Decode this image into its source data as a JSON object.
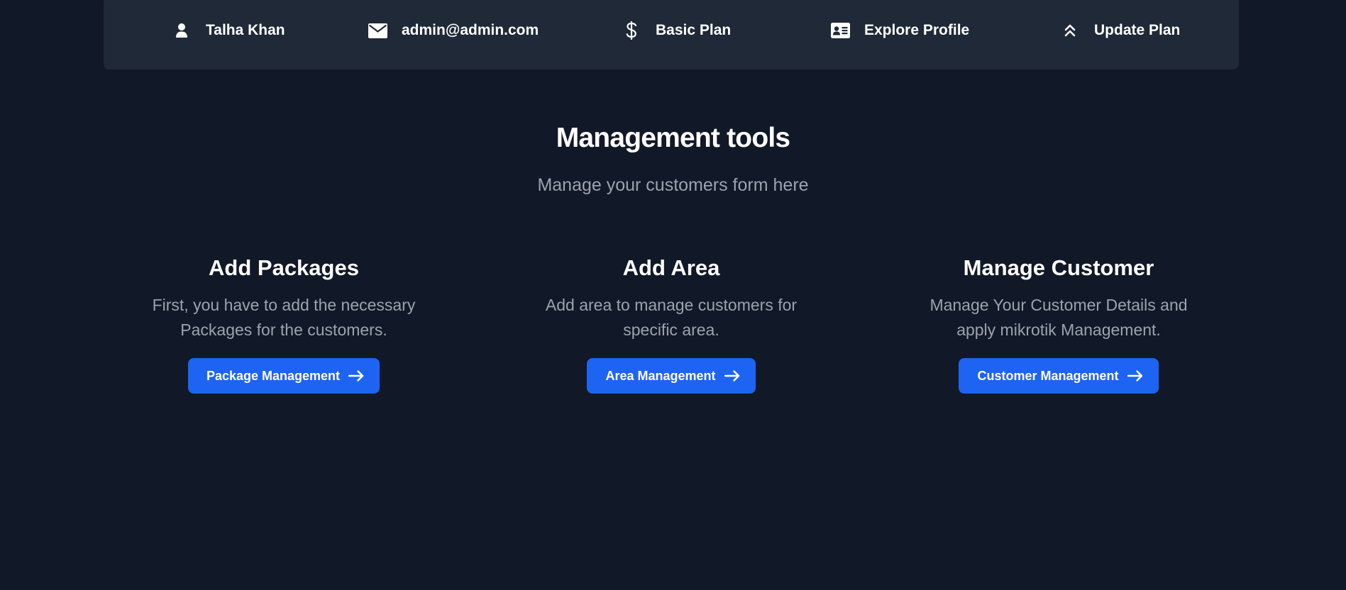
{
  "topbar": {
    "items": [
      {
        "label": "Talha Khan",
        "icon": "user-icon"
      },
      {
        "label": "admin@admin.com",
        "icon": "envelope-icon"
      },
      {
        "label": "Basic Plan",
        "icon": "dollar-icon"
      },
      {
        "label": "Explore Profile",
        "icon": "id-card-icon"
      },
      {
        "label": "Update Plan",
        "icon": "double-chevron-up-icon"
      }
    ]
  },
  "section": {
    "title": "Management tools",
    "subtitle": "Manage your customers form here"
  },
  "cards": [
    {
      "title": "Add Packages",
      "description": "First, you have to add the necessary Packages for the customers.",
      "button_label": "Package Management",
      "button_icon": "arrow-right-icon"
    },
    {
      "title": "Add Area",
      "description": "Add area to manage customers for specific area.",
      "button_label": "Area Management",
      "button_icon": "arrow-right-icon"
    },
    {
      "title": "Manage Customer",
      "description": "Manage Your Customer Details and apply mikrotik Management.",
      "button_label": "Customer Management",
      "button_icon": "arrow-right-icon"
    }
  ],
  "colors": {
    "background": "#111827",
    "topbar": "#1f2937",
    "button": "#1d64f2",
    "muted_text": "#9ca3af"
  }
}
